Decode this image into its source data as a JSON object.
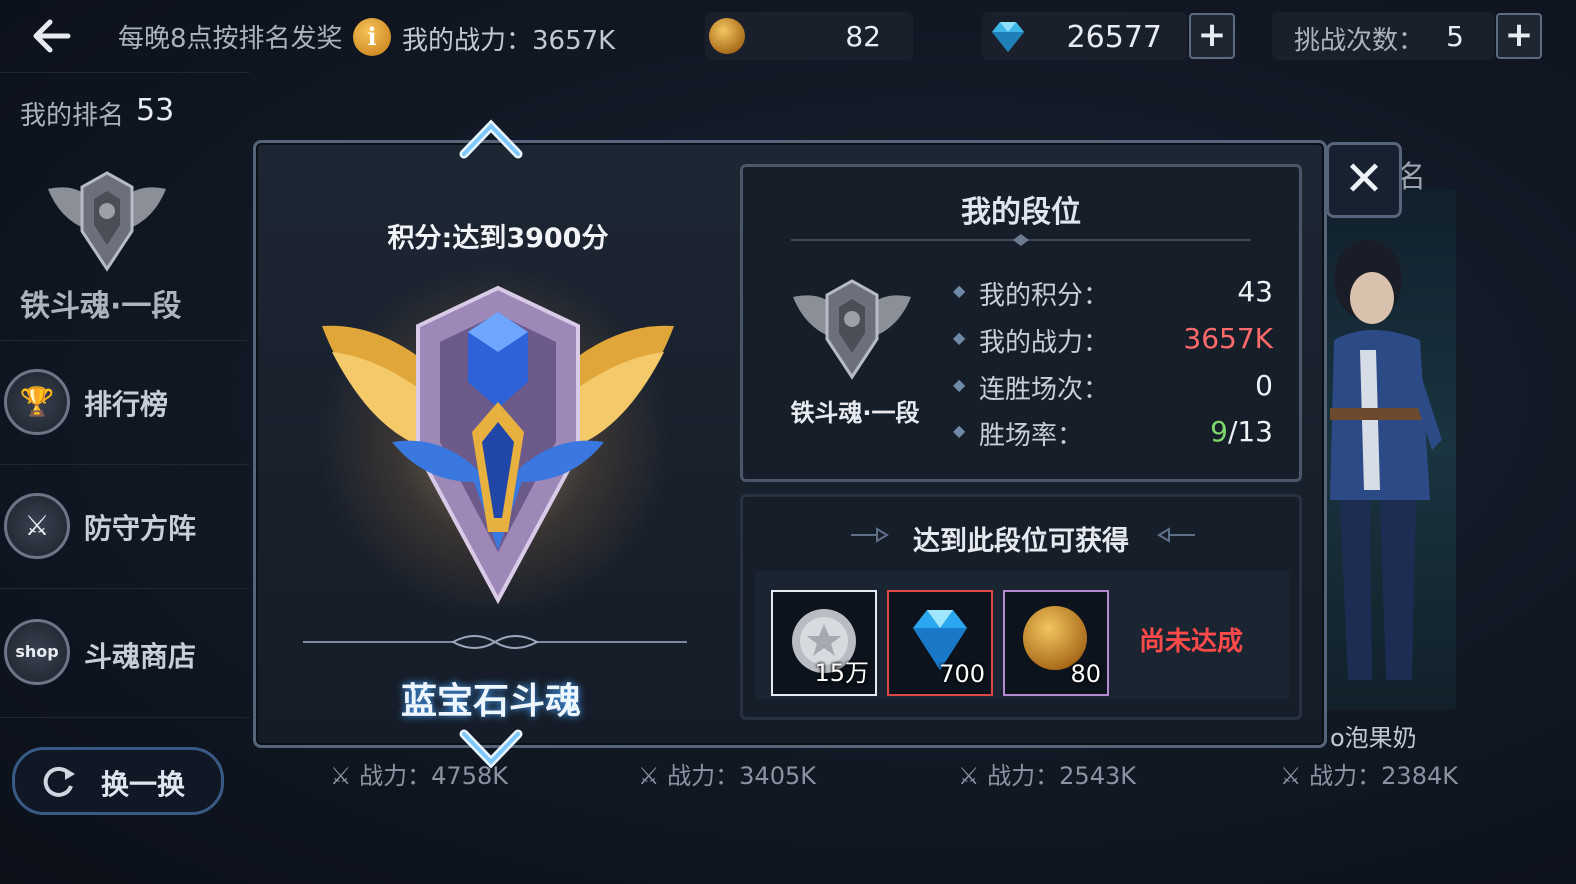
{
  "topbar": {
    "reward_note": "每晚8点按排名发奖",
    "my_power": "我的战力：3657K",
    "gold_amount": "82",
    "gem_amount": "26577",
    "challenge_label": "挑战次数：",
    "challenge_count": "5",
    "plus_symbol": "+"
  },
  "sidebar": {
    "my_rank_label": "我的排名",
    "my_rank_value": "53",
    "rank_name": "铁斗魂·一段",
    "items": [
      {
        "label": "排行榜",
        "icon": "trophy-icon"
      },
      {
        "label": "防守方阵",
        "icon": "shield-sword-icon"
      },
      {
        "label": "斗魂商店",
        "icon": "shop-icon"
      }
    ],
    "shop_icon_text": "shop",
    "swap_button": "换一换"
  },
  "background": {
    "partial_label": "名",
    "player_name": "o泡果奶",
    "powers": [
      "战力：4758K",
      "战力：3405K",
      "战力：2543K",
      "战力：2384K"
    ]
  },
  "modal": {
    "requirement": "积分:达到3900分",
    "tier_name": "蓝宝石斗魂",
    "close_symbol": "✕",
    "my_tier": {
      "title": "我的段位",
      "badge_name": "铁斗魂·一段",
      "rows": [
        {
          "label": "我的积分：",
          "value": "43"
        },
        {
          "label": "我的战力：",
          "value": "3657K"
        },
        {
          "label": "连胜场次：",
          "value": "0"
        },
        {
          "label": "胜场率：",
          "wins": "9",
          "total": "/13"
        }
      ]
    },
    "rewards": {
      "title": "达到此段位可获得",
      "items": [
        {
          "icon": "silver-coin-icon",
          "amount": "15万"
        },
        {
          "icon": "diamond-icon",
          "amount": "700"
        },
        {
          "icon": "gold-coin-icon",
          "amount": "80"
        }
      ],
      "status": "尚未达成"
    }
  },
  "colors": {
    "power_red": "#ff6a6a",
    "wins_green": "#7fd86a",
    "status_red": "#ff4a4a",
    "accent_blue": "#5aa9e6"
  }
}
